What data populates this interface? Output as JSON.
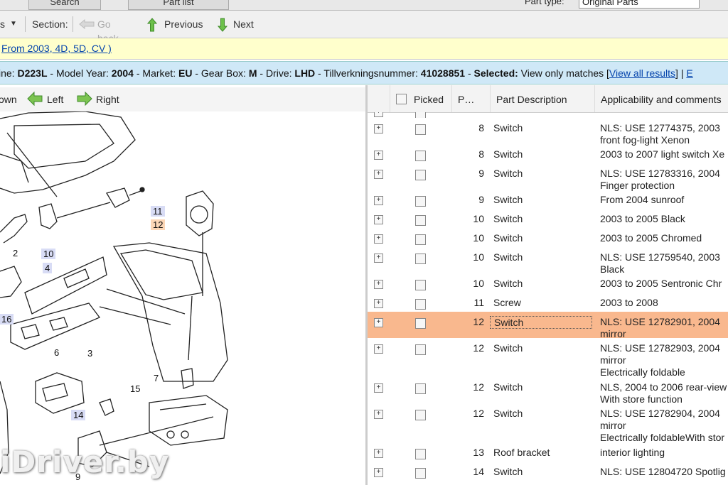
{
  "topbar": {
    "tab_search": "Search",
    "tab_partlist": "Part list",
    "part_type_label": "Part type:",
    "part_type_value": "Original Parts"
  },
  "toolbar": {
    "left_fragment": "s",
    "section_label": "Section:",
    "go_back_label": "Go back",
    "previous_label": "Previous",
    "next_label": "Next"
  },
  "breadcrumb": {
    "text": "From 2003, 4D, 5D, CV )"
  },
  "info": {
    "line_label": "ine:",
    "line_value": "D223L",
    "model_year_label": "Model Year:",
    "model_year_value": "2004",
    "market_label": "Market:",
    "market_value": "EU",
    "gearbox_label": "Gear Box:",
    "gearbox_value": "M",
    "drive_label": "Drive:",
    "drive_value": "LHD",
    "tillv_label": "Tillverkningsnummer:",
    "tillv_value": "41028851",
    "selected_label": "Selected:",
    "selected_value": "View only matches",
    "view_all": "View all results",
    "trailing": "E"
  },
  "diagram_toolbar": {
    "down_fragment": "own",
    "left_label": "Left",
    "right_label": "Right"
  },
  "callouts": [
    "11",
    "12",
    "2",
    "10",
    "4",
    "16",
    "6",
    "3",
    "7",
    "15",
    "14",
    "9"
  ],
  "watermark": "iDriver.by",
  "grid": {
    "headers": {
      "picked": "Picked",
      "pos": "P…",
      "desc": "Part Description",
      "appl": "Applicability and comments"
    },
    "rows": [
      {
        "pos": "8",
        "desc": "Switch",
        "appl": "NLS: USE 12774375, 2003\nfront fog-light Xenon",
        "selected": false
      },
      {
        "pos": "8",
        "desc": "Switch",
        "appl": "2003 to 2007 light switch Xe",
        "selected": false
      },
      {
        "pos": "9",
        "desc": "Switch",
        "appl": "NLS: USE 12783316, 2004\nFinger protection",
        "selected": false
      },
      {
        "pos": "9",
        "desc": "Switch",
        "appl": "From 2004 sunroof",
        "selected": false
      },
      {
        "pos": "10",
        "desc": "Switch",
        "appl": "2003 to 2005 Black",
        "selected": false
      },
      {
        "pos": "10",
        "desc": "Switch",
        "appl": "2003 to 2005 Chromed",
        "selected": false
      },
      {
        "pos": "10",
        "desc": "Switch",
        "appl": "NLS: USE 12759540, 2003\nBlack",
        "selected": false
      },
      {
        "pos": "10",
        "desc": "Switch",
        "appl": "2003 to 2005 Sentronic Chr",
        "selected": false
      },
      {
        "pos": "11",
        "desc": "Screw",
        "appl": "2003 to 2008",
        "selected": false
      },
      {
        "pos": "12",
        "desc": "Switch",
        "appl": "NLS: USE 12782901, 2004\nmirror",
        "selected": true
      },
      {
        "pos": "12",
        "desc": "Switch",
        "appl": "NLS: USE 12782903, 2004\nmirror\nElectrically foldable",
        "selected": false
      },
      {
        "pos": "12",
        "desc": "Switch",
        "appl": "NLS, 2004 to 2006 rear-view\nWith store function",
        "selected": false
      },
      {
        "pos": "12",
        "desc": "Switch",
        "appl": "NLS: USE 12782904, 2004\nmirror\nElectrically foldableWith stor",
        "selected": false
      },
      {
        "pos": "13",
        "desc": "Roof bracket",
        "appl": "interior lighting",
        "selected": false
      },
      {
        "pos": "14",
        "desc": "Switch",
        "appl": "NLS: USE 12804720 Spotlig",
        "selected": false
      }
    ]
  }
}
